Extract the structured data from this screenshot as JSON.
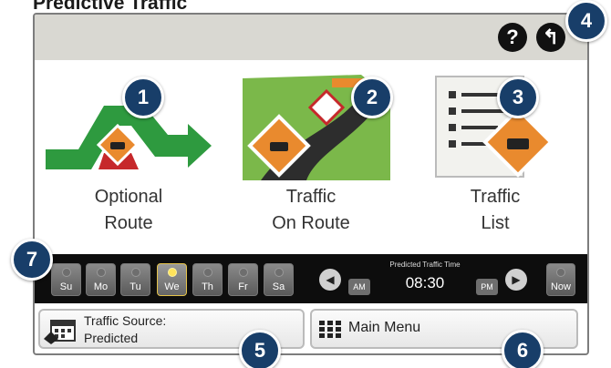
{
  "heading": "Predictive Traffic",
  "topbar": {
    "help_glyph": "?",
    "back_glyph": "↰"
  },
  "menu": [
    {
      "line1": "Optional",
      "line2": "Route",
      "icon": "optional-route-icon"
    },
    {
      "line1": "Traffic",
      "line2": "On Route",
      "icon": "traffic-on-route-icon"
    },
    {
      "line1": "Traffic",
      "line2": "List",
      "icon": "traffic-list-icon"
    }
  ],
  "days": [
    "Su",
    "Mo",
    "Tu",
    "We",
    "Th",
    "Fr",
    "Sa"
  ],
  "selected_day": "We",
  "time_bar": {
    "caption": "Predicted Traffic Time",
    "time": "08:30",
    "am": "AM",
    "pm": "PM",
    "now": "Now",
    "prev_glyph": "◀",
    "next_glyph": "▶"
  },
  "bottom": {
    "source_line1": "Traffic Source:",
    "source_line2": "Predicted",
    "main_menu": "Main Menu"
  },
  "callouts": [
    "1",
    "2",
    "3",
    "4",
    "5",
    "6",
    "7"
  ],
  "colors": {
    "callout": "#183e69",
    "warning": "#e98a2e",
    "route_green": "#2e9a3f",
    "route_red": "#c6282b"
  }
}
